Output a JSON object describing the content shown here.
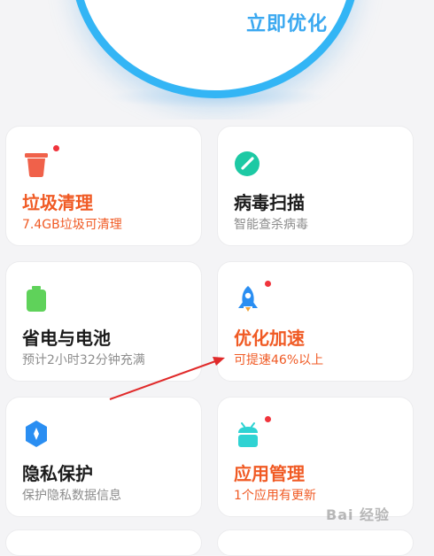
{
  "hero": {
    "button_label": "立即优化"
  },
  "cards": [
    {
      "title": "垃圾清理",
      "subtitle": "7.4GB垃圾可清理",
      "icon": "trash-bin-icon",
      "badge": true,
      "highlight": true
    },
    {
      "title": "病毒扫描",
      "subtitle": "智能查杀病毒",
      "icon": "virus-scan-icon",
      "badge": false,
      "highlight": false
    },
    {
      "title": "省电与电池",
      "subtitle": "预计2小时32分钟充满",
      "icon": "battery-icon",
      "badge": false,
      "highlight": false
    },
    {
      "title": "优化加速",
      "subtitle": "可提速46%以上",
      "icon": "rocket-icon",
      "badge": true,
      "highlight": true
    },
    {
      "title": "隐私保护",
      "subtitle": "保护隐私数据信息",
      "icon": "privacy-shield-icon",
      "badge": false,
      "highlight": false
    },
    {
      "title": "应用管理",
      "subtitle": "1个应用有更新",
      "icon": "android-app-icon",
      "badge": true,
      "highlight": true
    }
  ],
  "watermark": "Bai 经验",
  "colors": {
    "accent_blue": "#33b5f5",
    "highlight_orange": "#f05a24",
    "badge_red": "#f0343c"
  }
}
